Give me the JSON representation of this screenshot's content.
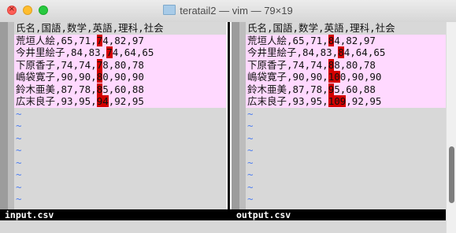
{
  "window": {
    "title": "teratail2 — vim — 79×19"
  },
  "left": {
    "status": "input.csv",
    "lines": [
      {
        "pre": "氏名,国語,数学,英語,理科,社会",
        "hl": "",
        "post": "",
        "diff": false
      },
      {
        "pre": "荒垣人絵,65,71,",
        "hl": "7",
        "post": "4,82,97",
        "diff": true
      },
      {
        "pre": "今井里絵子,84,83,",
        "hl": "7",
        "post": "4,64,65",
        "diff": true
      },
      {
        "pre": "下原香子,74,74,",
        "hl": "7",
        "post": "8,80,78",
        "diff": true
      },
      {
        "pre": "嶋袋寛子,90,90,",
        "hl": "8",
        "post": "0,90,90",
        "diff": true
      },
      {
        "pre": "鈴木亜美,87,78,",
        "hl": "8",
        "post": "5,60,88",
        "diff": true
      },
      {
        "pre": "広末良子,93,95,",
        "hl": "94",
        "post": ",92,95",
        "diff": true
      },
      {
        "pre": "~",
        "hl": "",
        "post": "",
        "diff": false,
        "tilde": true
      },
      {
        "pre": "~",
        "hl": "",
        "post": "",
        "diff": false,
        "tilde": true
      },
      {
        "pre": "~",
        "hl": "",
        "post": "",
        "diff": false,
        "tilde": true
      },
      {
        "pre": "~",
        "hl": "",
        "post": "",
        "diff": false,
        "tilde": true
      },
      {
        "pre": "~",
        "hl": "",
        "post": "",
        "diff": false,
        "tilde": true
      },
      {
        "pre": "~",
        "hl": "",
        "post": "",
        "diff": false,
        "tilde": true
      },
      {
        "pre": "~",
        "hl": "",
        "post": "",
        "diff": false,
        "tilde": true
      },
      {
        "pre": "~",
        "hl": "",
        "post": "",
        "diff": false,
        "tilde": true
      }
    ]
  },
  "right": {
    "status": "output.csv",
    "lines": [
      {
        "pre": "氏名,国語,数学,英語,理科,社会",
        "hl": "",
        "post": "",
        "diff": false
      },
      {
        "pre": "荒垣人絵,65,71,",
        "hl": "8",
        "post": "4,82,97",
        "diff": true
      },
      {
        "pre": "今井里絵子,84,83,",
        "hl": "8",
        "post": "4,64,65",
        "diff": true
      },
      {
        "pre": "下原香子,74,74,",
        "hl": "8",
        "post": "8,80,78",
        "diff": true
      },
      {
        "pre": "嶋袋寛子,90,90,",
        "hl": "10",
        "post": "0,90,90",
        "diff": true
      },
      {
        "pre": "鈴木亜美,87,78,",
        "hl": "9",
        "post": "5,60,88",
        "diff": true
      },
      {
        "pre": "広末良子,93,95,",
        "hl": "109",
        "post": ",92,95",
        "diff": true
      },
      {
        "pre": "~",
        "hl": "",
        "post": "",
        "diff": false,
        "tilde": true
      },
      {
        "pre": "~",
        "hl": "",
        "post": "",
        "diff": false,
        "tilde": true
      },
      {
        "pre": "~",
        "hl": "",
        "post": "",
        "diff": false,
        "tilde": true
      },
      {
        "pre": "~",
        "hl": "",
        "post": "",
        "diff": false,
        "tilde": true
      },
      {
        "pre": "~",
        "hl": "",
        "post": "",
        "diff": false,
        "tilde": true
      },
      {
        "pre": "~",
        "hl": "",
        "post": "",
        "diff": false,
        "tilde": true
      },
      {
        "pre": "~",
        "hl": "",
        "post": "",
        "diff": false,
        "tilde": true
      },
      {
        "pre": "~",
        "hl": "",
        "post": "",
        "diff": false,
        "tilde": true
      }
    ]
  },
  "colors": {
    "diff_bg": "#ffd9ff",
    "diff_hl": "#d30000",
    "tilde": "#4a7cf0"
  }
}
